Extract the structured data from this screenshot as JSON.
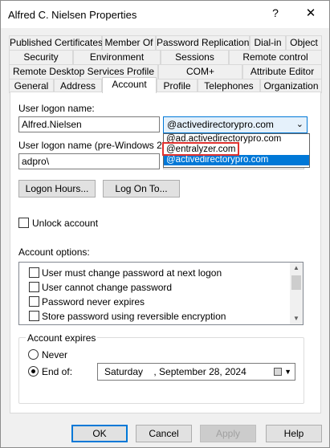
{
  "window": {
    "title": "Alfred C. Nielsen Properties",
    "help_glyph": "?",
    "close_glyph": "✕"
  },
  "tabs": {
    "row1": [
      "Published Certificates",
      "Member Of",
      "Password Replication",
      "Dial-in",
      "Object"
    ],
    "row2": [
      "Security",
      "Environment",
      "Sessions",
      "Remote control"
    ],
    "row3": [
      "Remote Desktop Services Profile",
      "COM+",
      "Attribute Editor"
    ],
    "row4": [
      "General",
      "Address",
      "Account",
      "Profile",
      "Telephones",
      "Organization"
    ],
    "active": "Account"
  },
  "account": {
    "logon_name_label": "User logon name:",
    "logon_name_value": "Alfred.Nielsen",
    "upn_suffix_selected": "@activedirectorypro.com",
    "upn_suffix_options": [
      "@ad.activedirectorypro.com",
      "@entralyzer.com",
      "@activedirectorypro.com"
    ],
    "pre2000_label": "User logon name (pre-Windows 2000):",
    "pre2000_domain": "adpro\\",
    "logon_hours_button": "Logon Hours...",
    "log_on_to_button": "Log On To...",
    "unlock_label": "Unlock account",
    "account_options_label": "Account options:",
    "options": [
      {
        "label": "User must change password at next logon",
        "checked": false
      },
      {
        "label": "User cannot change password",
        "checked": false
      },
      {
        "label": "Password never expires",
        "checked": false
      },
      {
        "label": "Store password using reversible encryption",
        "checked": false
      }
    ],
    "expires_group_label": "Account expires",
    "never_label": "Never",
    "end_of_label": "End of:",
    "end_of_checked": true,
    "end_of_date": "Saturday    , September 28, 2024"
  },
  "buttons": {
    "ok": "OK",
    "cancel": "Cancel",
    "apply": "Apply",
    "help": "Help"
  },
  "colors": {
    "accent": "#0078d7",
    "highlight_box": "#e0322f"
  }
}
